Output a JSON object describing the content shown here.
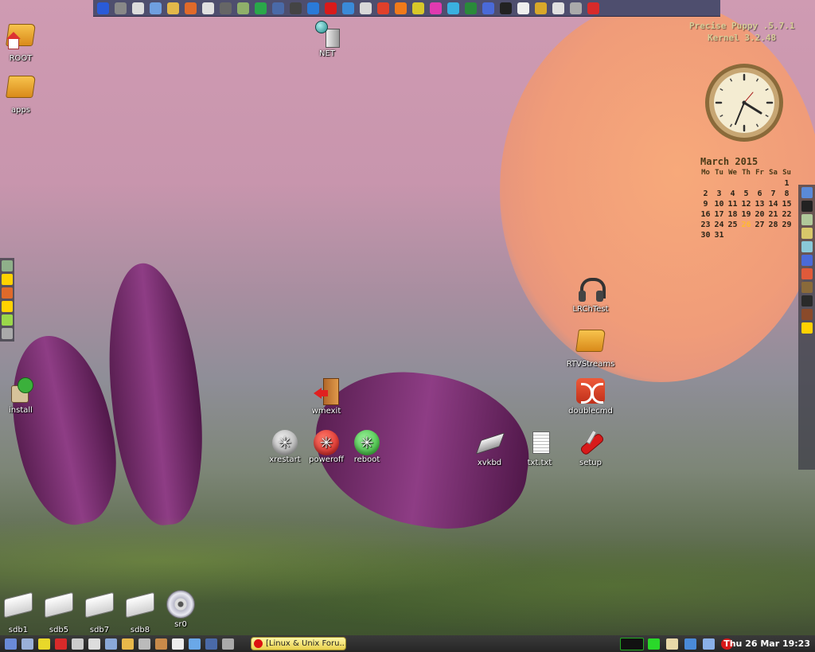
{
  "top_bar": {
    "items": [
      {
        "icon": "monitor-icon",
        "color": "#2a5bd8"
      },
      {
        "icon": "tools-icon",
        "color": "#888888"
      },
      {
        "icon": "disc-icon",
        "color": "#dcdcdc"
      },
      {
        "icon": "image-viewer-icon",
        "color": "#6f9fe0"
      },
      {
        "icon": "file-manager-icon",
        "color": "#e3b84a"
      },
      {
        "icon": "user-icon",
        "color": "#e06a2a"
      },
      {
        "icon": "printer-icon",
        "color": "#e0e0e0"
      },
      {
        "icon": "settings-icon",
        "color": "#666666"
      },
      {
        "icon": "scanner-icon",
        "color": "#8fb06a"
      },
      {
        "icon": "graph-icon",
        "color": "#2aa84a"
      },
      {
        "icon": "network-icon",
        "color": "#4a6aa8"
      },
      {
        "icon": "film-icon",
        "color": "#444444"
      },
      {
        "icon": "globe-icon",
        "color": "#2a7ad8"
      },
      {
        "icon": "opera-icon",
        "color": "#d81a1a"
      },
      {
        "icon": "chat-icon",
        "color": "#3a8ad8"
      },
      {
        "icon": "mail-icon",
        "color": "#d8d8d8"
      },
      {
        "icon": "chrome-icon",
        "color": "#e0402a"
      },
      {
        "icon": "firefox-icon",
        "color": "#f07a1a"
      },
      {
        "icon": "cd-burner-icon",
        "color": "#d8c82a"
      },
      {
        "icon": "paint-icon",
        "color": "#e03ab0"
      },
      {
        "icon": "calculator-icon",
        "color": "#3ab0e0"
      },
      {
        "icon": "spreadsheet-icon",
        "color": "#2a8a3a"
      },
      {
        "icon": "grid-icon",
        "color": "#4a6ad8"
      },
      {
        "icon": "pointer-icon",
        "color": "#222222"
      },
      {
        "icon": "clock-icon",
        "color": "#eeeeee"
      },
      {
        "icon": "chart-icon",
        "color": "#d8a82a"
      },
      {
        "icon": "speaker-icon",
        "color": "#e0e0e0"
      },
      {
        "icon": "keyboard-icon",
        "color": "#aaaaaa"
      },
      {
        "icon": "power-icon",
        "color": "#d82a2a"
      }
    ]
  },
  "system_info": {
    "line1": "Precise Puppy .5.7.1",
    "line2": "Kernel 3.2.48"
  },
  "calendar": {
    "title": "March  2015",
    "day_headers": [
      "Mo",
      "Tu",
      "We",
      "Th",
      "Fr",
      "Sa",
      "Su"
    ],
    "days": [
      "",
      "",
      "",
      "",
      "",
      "",
      "1",
      "2",
      "3",
      "4",
      "5",
      "6",
      "7",
      "8",
      "9",
      "10",
      "11",
      "12",
      "13",
      "14",
      "15",
      "16",
      "17",
      "18",
      "19",
      "20",
      "21",
      "22",
      "23",
      "24",
      "25",
      "26",
      "27",
      "28",
      "29",
      "30",
      "31"
    ],
    "today": "26"
  },
  "desktop_icons": [
    {
      "id": "root",
      "label": "ROOT",
      "type": "home"
    },
    {
      "id": "apps",
      "label": "apps",
      "type": "folder"
    },
    {
      "id": "net",
      "label": "NET",
      "type": "network"
    },
    {
      "id": "install",
      "label": "install",
      "type": "install"
    },
    {
      "id": "lrchtest",
      "label": "LRChTest",
      "type": "headphones"
    },
    {
      "id": "rtvstreams",
      "label": "RTVStreams",
      "type": "folder"
    },
    {
      "id": "doublecmd",
      "label": "doublecmd",
      "type": "doublecmd"
    },
    {
      "id": "wmexit",
      "label": "wmexit",
      "type": "exit"
    },
    {
      "id": "xrestart",
      "label": "xrestart",
      "type": "restart"
    },
    {
      "id": "poweroff",
      "label": "poweroff",
      "type": "poweroff"
    },
    {
      "id": "reboot",
      "label": "reboot",
      "type": "reboot"
    },
    {
      "id": "xvkbd",
      "label": "xvkbd",
      "type": "keyboard"
    },
    {
      "id": "txttxt",
      "label": "txt.txt",
      "type": "textfile"
    },
    {
      "id": "setup",
      "label": "setup",
      "type": "setup"
    }
  ],
  "drives": [
    {
      "label": "sdb1",
      "type": "drive"
    },
    {
      "label": "sdb5",
      "type": "drive"
    },
    {
      "label": "sdb7",
      "type": "drive"
    },
    {
      "label": "sdb8",
      "type": "drive"
    },
    {
      "label": "sr0",
      "type": "optical"
    }
  ],
  "left_strip": [
    "drive-icon",
    "bolt-icon",
    "user-icon",
    "bolt-icon",
    "disc-icon",
    "gear-icon"
  ],
  "right_strip": [
    "globe-icon",
    "chess-icon",
    "map-icon",
    "puzzle-icon",
    "monitor-icon",
    "dots-icon",
    "chart-icon",
    "pen-icon",
    "frog-icon",
    "bear-icon",
    "bolt-icon"
  ],
  "taskbar": {
    "launchers": [
      {
        "icon": "show-desktop-icon",
        "color": "#6a8ad8"
      },
      {
        "icon": "windows-icon",
        "color": "#9ab0d8"
      },
      {
        "icon": "note-icon",
        "color": "#e8d82a"
      },
      {
        "icon": "pencil-icon",
        "color": "#d82a2a"
      },
      {
        "icon": "search-icon",
        "color": "#cccccc"
      },
      {
        "icon": "drive-icon",
        "color": "#dddddd"
      },
      {
        "icon": "network-icon",
        "color": "#8aa8d8"
      },
      {
        "icon": "folder-icon",
        "color": "#e8b84a"
      },
      {
        "icon": "tools-icon",
        "color": "#bbbbbb"
      },
      {
        "icon": "archive-icon",
        "color": "#c88a4a"
      },
      {
        "icon": "doc-icon",
        "color": "#eeeeee"
      },
      {
        "icon": "cube-icon",
        "color": "#6aa8e8"
      },
      {
        "icon": "calc-icon",
        "color": "#4a6aa8"
      },
      {
        "icon": "edit-icon",
        "color": "#aaaaaa"
      }
    ],
    "active_task": "[Linux & Unix Foru...",
    "tray": [
      {
        "icon": "cpu-meter-icon",
        "color": "#111111"
      },
      {
        "icon": "battery-icon",
        "color": "#2ad82a"
      },
      {
        "icon": "clipboard-icon",
        "color": "#e8d8a8"
      },
      {
        "icon": "network-status-icon",
        "color": "#4a8ad8"
      },
      {
        "icon": "volume-icon",
        "color": "#8ab0e8"
      },
      {
        "icon": "opera-icon",
        "color": "#d81a1a"
      }
    ],
    "datetime": "Thu 26 Mar 19:23"
  }
}
